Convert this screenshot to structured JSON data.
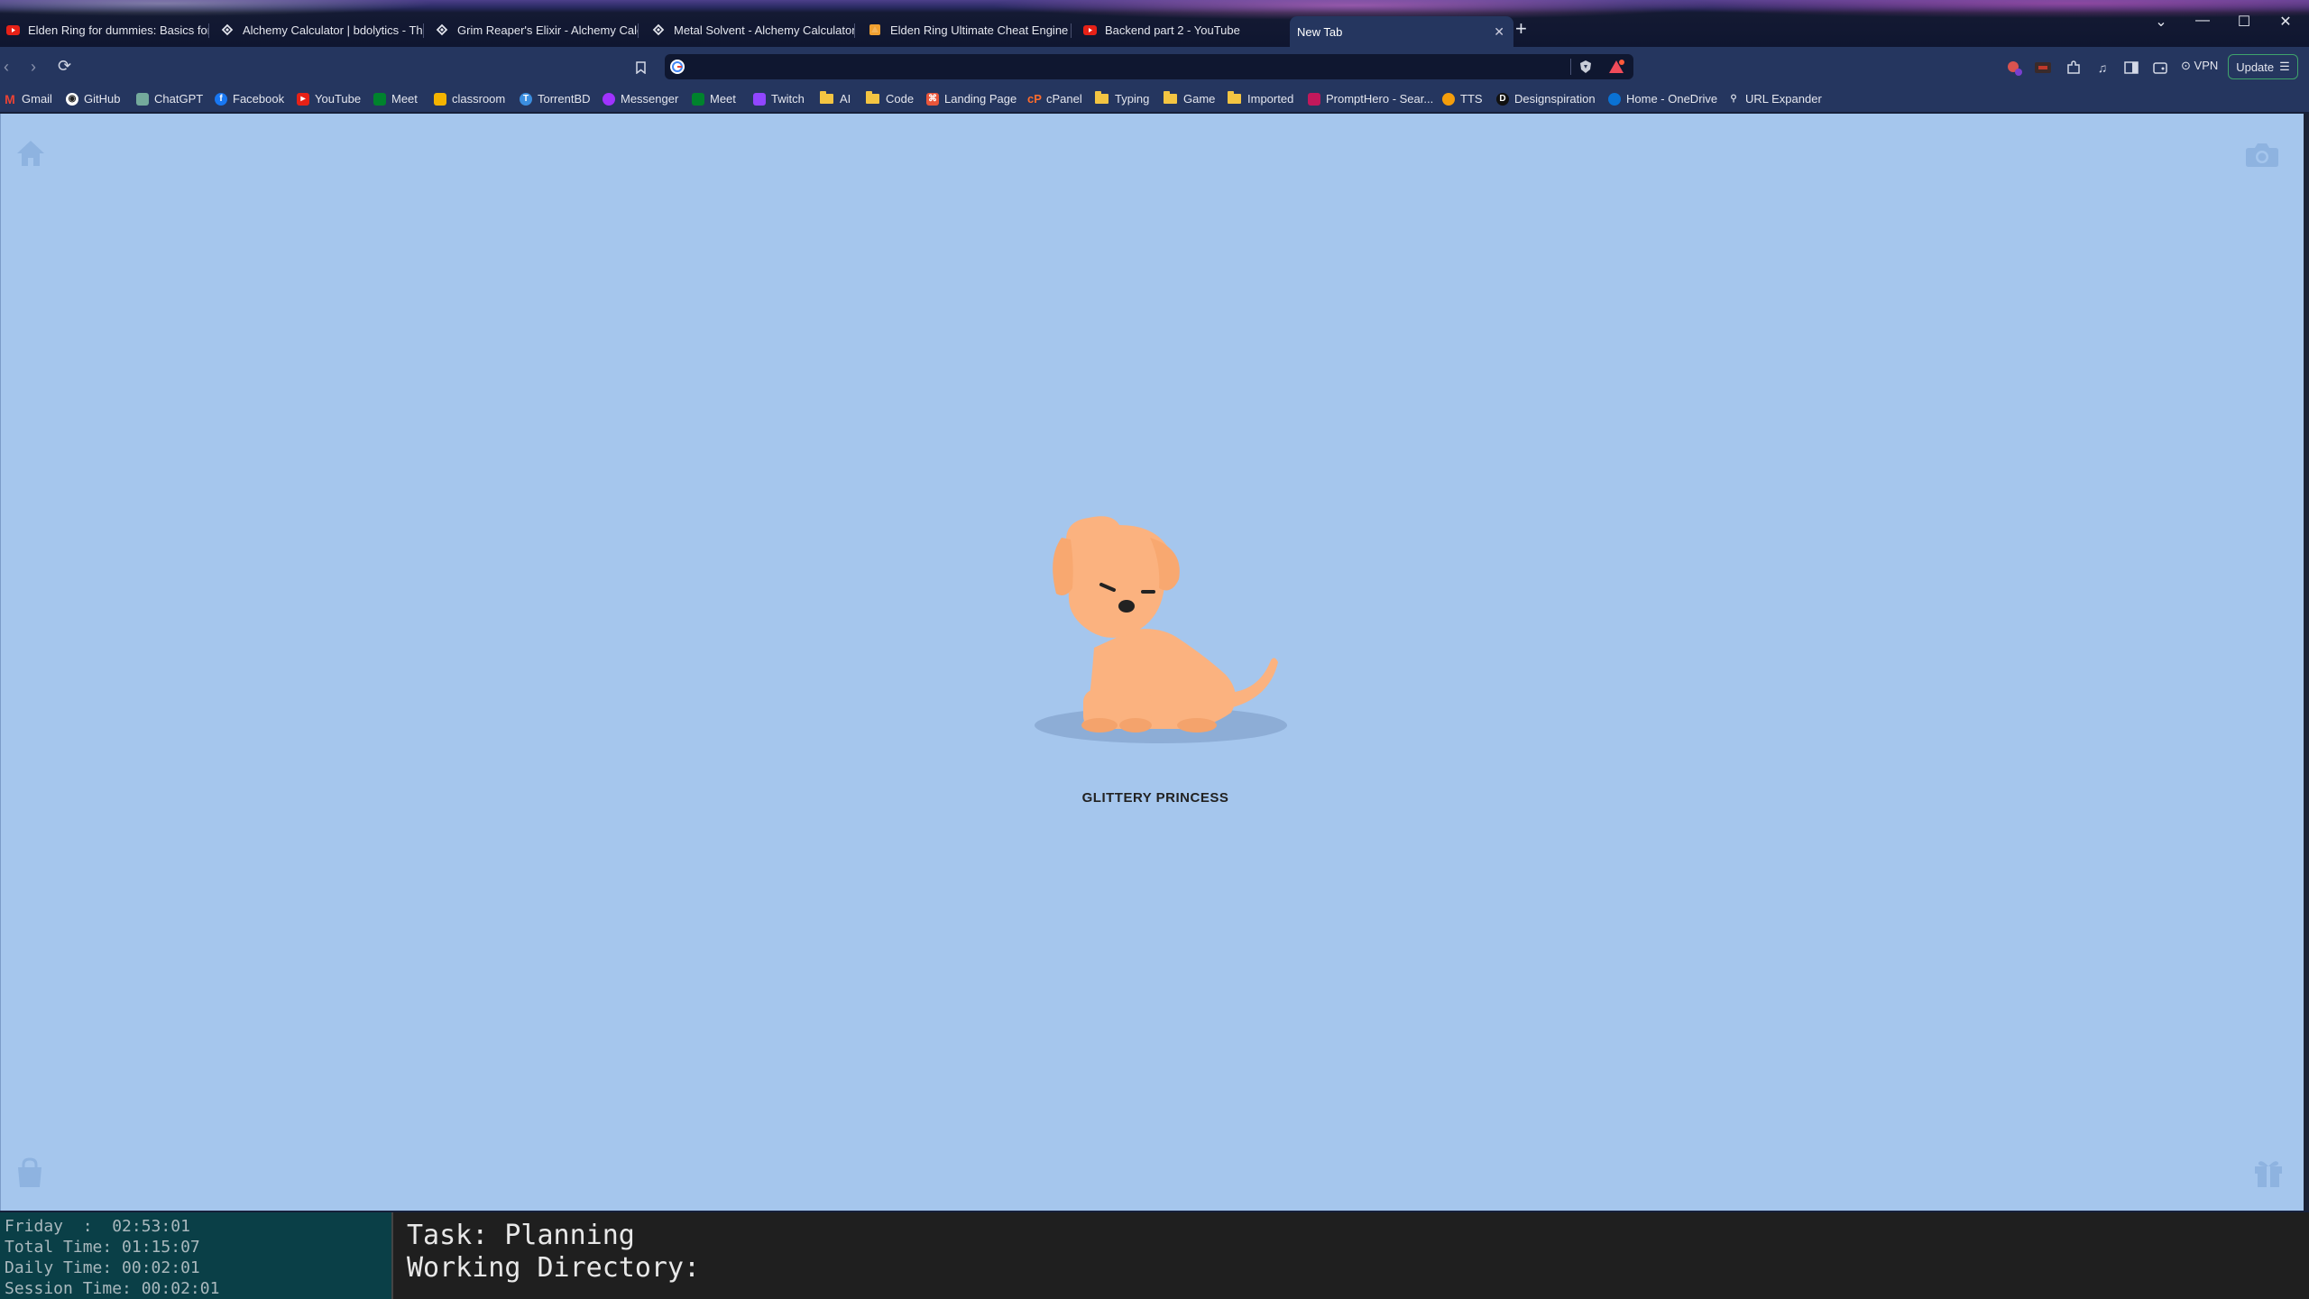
{
  "tabs": [
    {
      "title": "Elden Ring for dummies: Basics for E",
      "favicon": "youtube-icon"
    },
    {
      "title": "Alchemy Calculator | bdolytics - The",
      "favicon": "bdolytics-icon"
    },
    {
      "title": "Grim Reaper's Elixir - Alchemy Calcu",
      "favicon": "bdolytics-icon"
    },
    {
      "title": "Metal Solvent - Alchemy Calculator |",
      "favicon": "bdolytics-icon"
    },
    {
      "title": "Elden Ring Ultimate Cheat Engine Ta",
      "favicon": "cheat-engine-icon"
    },
    {
      "title": "Backend part 2 - YouTube",
      "favicon": "youtube-icon"
    },
    {
      "title": "New Tab",
      "favicon": "none",
      "active": true
    }
  ],
  "toolbar": {
    "address_value": "",
    "vpn_label": "VPN",
    "update_label": "Update",
    "shields_badge": "",
    "rewards_badge": "7"
  },
  "bookmarks": [
    {
      "label": "Gmail",
      "icon": "gmail-icon"
    },
    {
      "label": "GitHub",
      "icon": "github-icon"
    },
    {
      "label": "ChatGPT",
      "icon": "chatgpt-icon"
    },
    {
      "label": "Facebook",
      "icon": "facebook-icon"
    },
    {
      "label": "YouTube",
      "icon": "youtube-icon"
    },
    {
      "label": "Meet",
      "icon": "meet-icon"
    },
    {
      "label": "classroom",
      "icon": "classroom-icon"
    },
    {
      "label": "TorrentBD",
      "icon": "torrentbd-icon"
    },
    {
      "label": "Messenger",
      "icon": "messenger-icon"
    },
    {
      "label": "Meet",
      "icon": "meet-icon"
    },
    {
      "label": "Twitch",
      "icon": "twitch-icon"
    },
    {
      "label": "AI",
      "icon": "folder-icon"
    },
    {
      "label": "Code",
      "icon": "folder-icon"
    },
    {
      "label": "Landing Page",
      "icon": "landing-page-icon"
    },
    {
      "label": "cPanel",
      "icon": "cpanel-icon"
    },
    {
      "label": "Typing",
      "icon": "folder-icon"
    },
    {
      "label": "Game",
      "icon": "folder-icon"
    },
    {
      "label": "Imported",
      "icon": "folder-icon"
    },
    {
      "label": "PromptHero - Sear...",
      "icon": "prompthero-icon"
    },
    {
      "label": "TTS",
      "icon": "tts-icon"
    },
    {
      "label": "Designspiration",
      "icon": "designspiration-icon"
    },
    {
      "label": "Home - OneDrive",
      "icon": "onedrive-icon"
    },
    {
      "label": "URL Expander",
      "icon": "url-expander-icon"
    }
  ],
  "page": {
    "pet_name": "GLITTERY PRINCESS",
    "background": "#a5c6ed",
    "dog_color": "#fbb27f"
  },
  "timer": {
    "day_line": "Friday  :  02:53:01",
    "total_line": "Total Time: 01:15:07",
    "daily_line": "Daily Time: 00:02:01",
    "session_line": "Session Time: 00:02:01"
  },
  "task": {
    "task_line": "Task: Planning",
    "dir_line": "Working Directory:"
  }
}
